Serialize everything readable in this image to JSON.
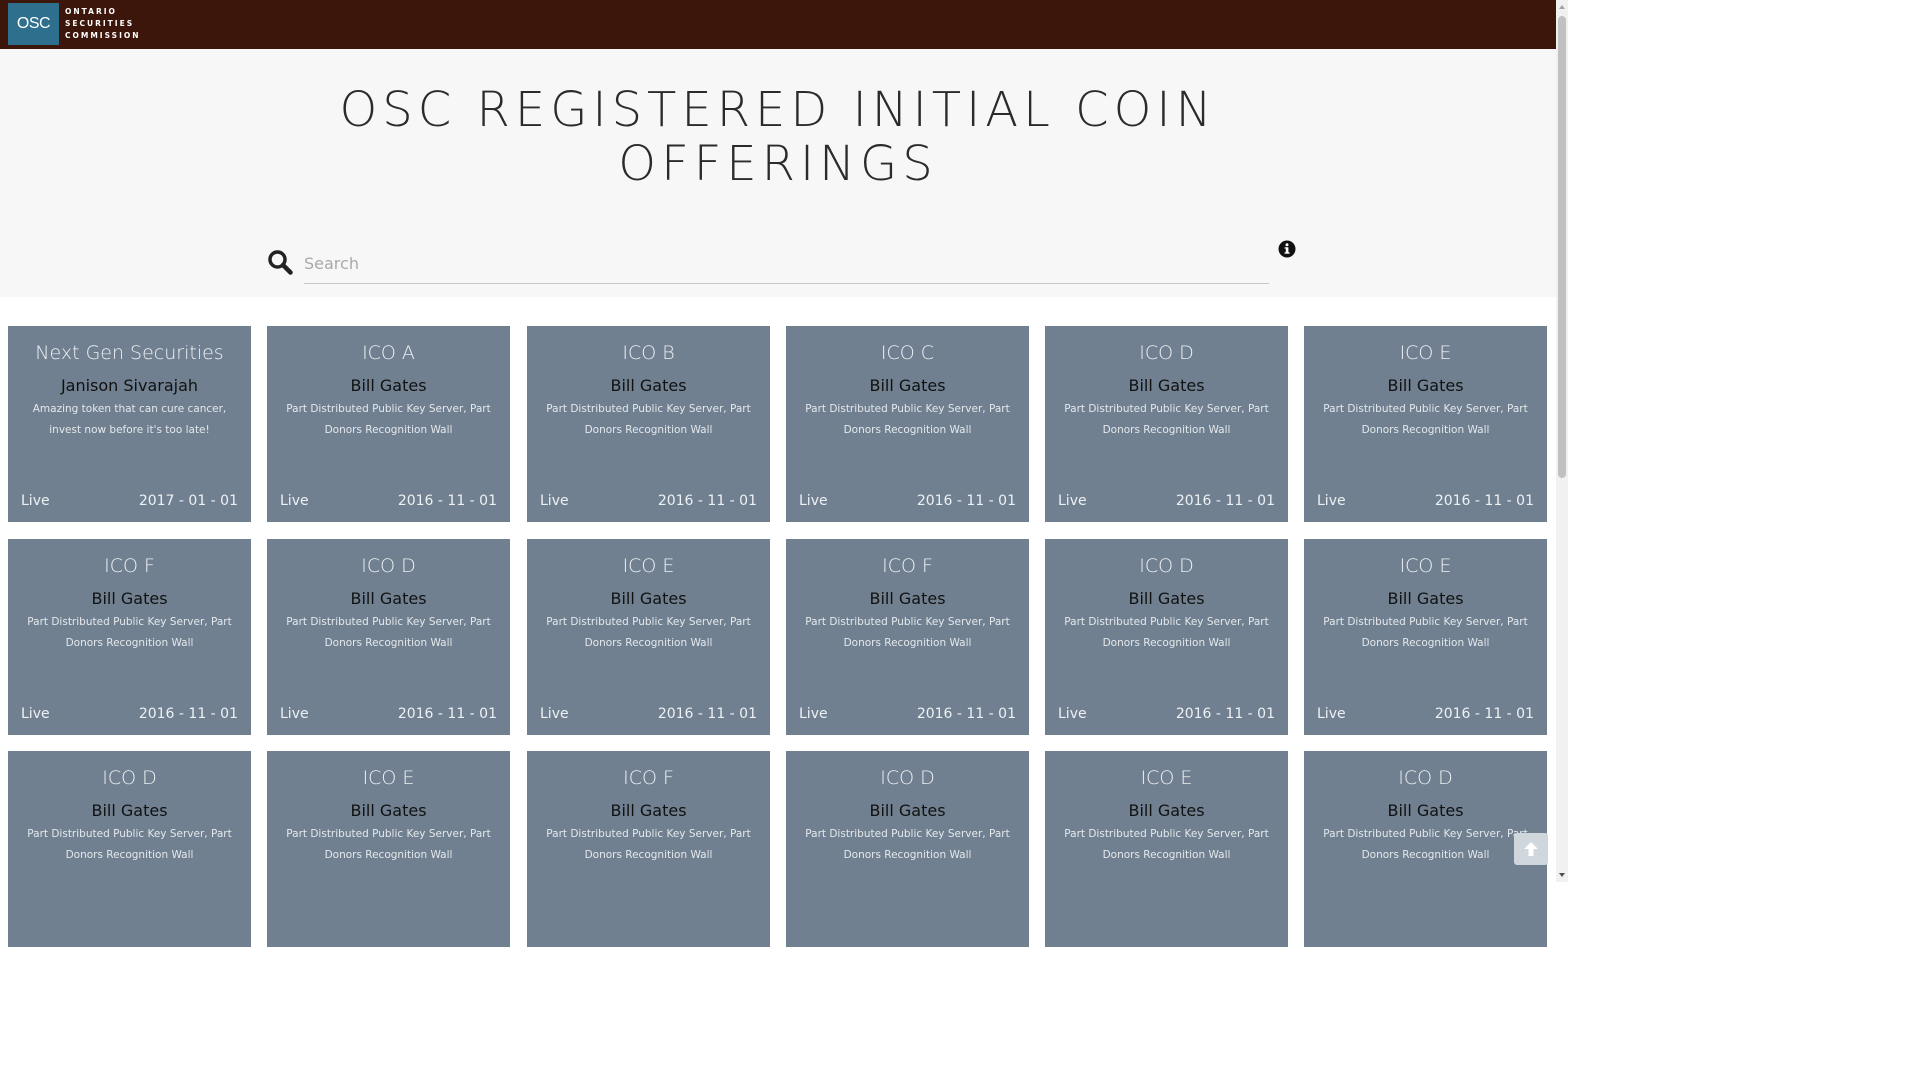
{
  "header": {
    "logo_abbr": "OSC",
    "logo_lines": [
      "ONTARIO",
      "SECURITIES",
      "COMMISSION"
    ]
  },
  "hero": {
    "title": "OSC REGISTERED INITIAL COIN OFFERINGS",
    "search_placeholder": "Search",
    "search_value": ""
  },
  "colors": {
    "topbar": "#3d160b",
    "card_bg": "#708090",
    "hero_bg": "#f7f7f7"
  },
  "icons": {
    "search": "search-icon",
    "info": "info-icon",
    "back_to_top": "arrow-up-icon"
  },
  "cards": [
    {
      "title": "Next Gen Securities",
      "owner": "Janison Sivarajah",
      "description": "Amazing token that can cure cancer, invest now before it's too late!",
      "status": "Live",
      "date": "2017 - 01 - 01"
    },
    {
      "title": "ICO A",
      "owner": "Bill Gates",
      "description": "Part Distributed Public Key Server, Part Donors Recognition Wall",
      "status": "Live",
      "date": "2016 - 11 - 01"
    },
    {
      "title": "ICO B",
      "owner": "Bill Gates",
      "description": "Part Distributed Public Key Server, Part Donors Recognition Wall",
      "status": "Live",
      "date": "2016 - 11 - 01"
    },
    {
      "title": "ICO C",
      "owner": "Bill Gates",
      "description": "Part Distributed Public Key Server, Part Donors Recognition Wall",
      "status": "Live",
      "date": "2016 - 11 - 01"
    },
    {
      "title": "ICO D",
      "owner": "Bill Gates",
      "description": "Part Distributed Public Key Server, Part Donors Recognition Wall",
      "status": "Live",
      "date": "2016 - 11 - 01"
    },
    {
      "title": "ICO E",
      "owner": "Bill Gates",
      "description": "Part Distributed Public Key Server, Part Donors Recognition Wall",
      "status": "Live",
      "date": "2016 - 11 - 01"
    },
    {
      "title": "ICO F",
      "owner": "Bill Gates",
      "description": "Part Distributed Public Key Server, Part Donors Recognition Wall",
      "status": "Live",
      "date": "2016 - 11 - 01"
    },
    {
      "title": "ICO D",
      "owner": "Bill Gates",
      "description": "Part Distributed Public Key Server, Part Donors Recognition Wall",
      "status": "Live",
      "date": "2016 - 11 - 01"
    },
    {
      "title": "ICO E",
      "owner": "Bill Gates",
      "description": "Part Distributed Public Key Server, Part Donors Recognition Wall",
      "status": "Live",
      "date": "2016 - 11 - 01"
    },
    {
      "title": "ICO F",
      "owner": "Bill Gates",
      "description": "Part Distributed Public Key Server, Part Donors Recognition Wall",
      "status": "Live",
      "date": "2016 - 11 - 01"
    },
    {
      "title": "ICO D",
      "owner": "Bill Gates",
      "description": "Part Distributed Public Key Server, Part Donors Recognition Wall",
      "status": "Live",
      "date": "2016 - 11 - 01"
    },
    {
      "title": "ICO E",
      "owner": "Bill Gates",
      "description": "Part Distributed Public Key Server, Part Donors Recognition Wall",
      "status": "Live",
      "date": "2016 - 11 - 01"
    },
    {
      "title": "ICO D",
      "owner": "Bill Gates",
      "description": "Part Distributed Public Key Server, Part Donors Recognition Wall",
      "status": "",
      "date": ""
    },
    {
      "title": "ICO E",
      "owner": "Bill Gates",
      "description": "Part Distributed Public Key Server, Part Donors Recognition Wall",
      "status": "",
      "date": ""
    },
    {
      "title": "ICO F",
      "owner": "Bill Gates",
      "description": "Part Distributed Public Key Server, Part Donors Recognition Wall",
      "status": "",
      "date": ""
    },
    {
      "title": "ICO D",
      "owner": "Bill Gates",
      "description": "Part Distributed Public Key Server, Part Donors Recognition Wall",
      "status": "",
      "date": ""
    },
    {
      "title": "ICO E",
      "owner": "Bill Gates",
      "description": "Part Distributed Public Key Server, Part Donors Recognition Wall",
      "status": "",
      "date": ""
    },
    {
      "title": "ICO D",
      "owner": "Bill Gates",
      "description": "Part Distributed Public Key Server, Part Donors Recognition Wall",
      "status": "",
      "date": ""
    }
  ]
}
